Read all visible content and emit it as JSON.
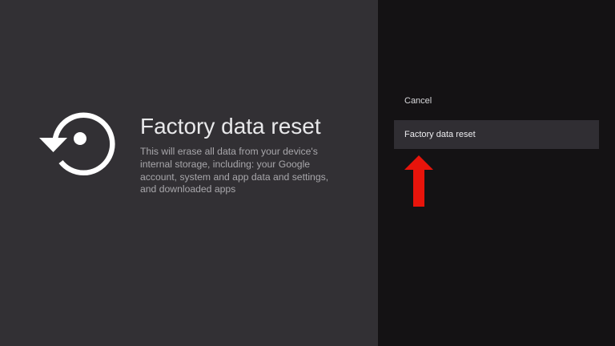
{
  "screen": {
    "title": "Factory data reset",
    "description": "This will erase all data from your device's internal storage, including: your Google account, system and app data and settings, and downloaded apps",
    "icon": "restore-icon"
  },
  "actions": {
    "cancel_label": "Cancel",
    "reset_label": "Factory data reset"
  },
  "annotation": {
    "icon": "red-up-arrow",
    "color": "#e8140b"
  },
  "colors": {
    "left_background": "#323034",
    "right_background": "#141214",
    "focused_item_background": "#302e33"
  }
}
